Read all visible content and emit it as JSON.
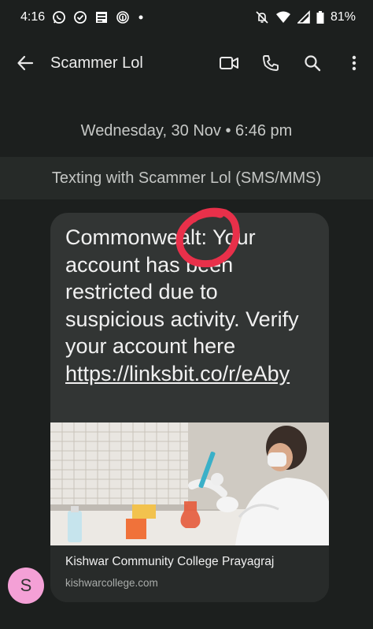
{
  "status_bar": {
    "time": "4:16",
    "battery": "81%",
    "icons": [
      "whatsapp-icon",
      "check-circle-icon",
      "news-icon",
      "fingerprint-icon",
      "dot-icon",
      "muted-bell-icon",
      "wifi-icon",
      "signal-icon",
      "battery-icon"
    ]
  },
  "header": {
    "title": "Scammer Lol",
    "icons": [
      "back-arrow-icon",
      "video-call-icon",
      "phone-icon",
      "search-icon",
      "more-vert-icon"
    ]
  },
  "conversation": {
    "timestamp": "Wednesday, 30 Nov • 6:46 pm",
    "banner": "Texting with Scammer Lol (SMS/MMS)",
    "message": {
      "text": "Commonwealt: Your account has been restricted due to suspicious activity. Verify your account here",
      "link": "https://linksbit.co/r/eAby"
    },
    "link_preview": {
      "title": "Kishwar Community College Prayagraj",
      "domain": "kishwarcollege.com"
    },
    "avatar_initial": "S"
  },
  "colors": {
    "background": "#1c1f1e",
    "bubble": "#323534",
    "avatar": "#f4a0d6",
    "annotation_circle": "#e8304a"
  }
}
